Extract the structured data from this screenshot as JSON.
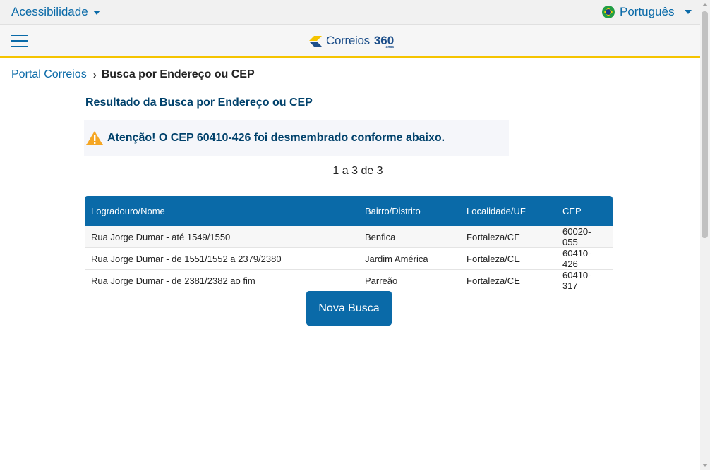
{
  "topbar": {
    "accessibility_label": "Acessibilidade",
    "language_label": "Português"
  },
  "navbar": {
    "menu_icon": "hamburger-icon",
    "logo_brand": "Correios",
    "logo_anniversary": "360",
    "logo_anniversary_sub": "anos"
  },
  "breadcrumb": {
    "home": "Portal Correios",
    "separator": "›",
    "current": "Busca por Endereço ou CEP"
  },
  "main": {
    "title": "Resultado da Busca por Endereço ou CEP",
    "alert_icon": "warning-icon",
    "alert_message": "Atenção! O CEP 60410-426 foi desmembrado conforme abaixo.",
    "pagination": "1 a 3 de 3",
    "table": {
      "headers": [
        "Logradouro/Nome",
        "Bairro/Distrito",
        "Localidade/UF",
        "CEP"
      ],
      "rows": [
        [
          "Rua Jorge Dumar - até 1549/1550",
          "Benfica",
          "Fortaleza/CE",
          "60020-055"
        ],
        [
          "Rua Jorge Dumar - de 1551/1552 a 2379/2380",
          "Jardim América",
          "Fortaleza/CE",
          "60410-426"
        ],
        [
          "Rua Jorge Dumar - de 2381/2382 ao fim",
          "Parreão",
          "Fortaleza/CE",
          "60410-317"
        ]
      ]
    },
    "new_search_label": "Nova Busca"
  },
  "colors": {
    "primary_blue": "#0a6aa8",
    "title_navy": "#00416b",
    "accent_yellow": "#f5c400",
    "warning_orange": "#f5a623"
  }
}
